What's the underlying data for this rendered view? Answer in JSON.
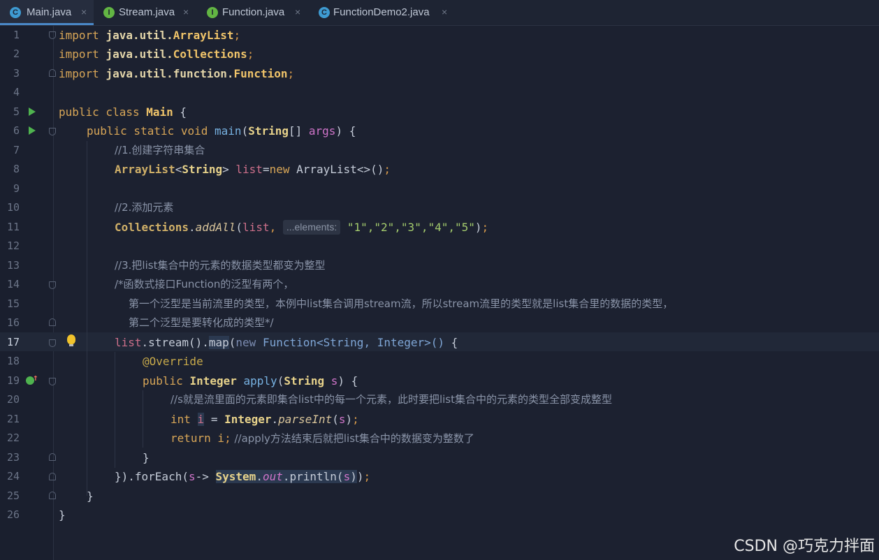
{
  "tabs": [
    {
      "label": "Main.java",
      "icon": "C",
      "kind": "class",
      "active": true
    },
    {
      "label": "Stream.java",
      "icon": "I",
      "kind": "interface",
      "active": false
    },
    {
      "label": "Function.java",
      "icon": "I",
      "kind": "interface",
      "active": false
    },
    {
      "label": "FunctionDemo2.java",
      "icon": "C",
      "kind": "class",
      "active": false
    }
  ],
  "close_glyph": "×",
  "line_numbers": [
    "1",
    "2",
    "3",
    "4",
    "5",
    "6",
    "7",
    "8",
    "9",
    "10",
    "11",
    "12",
    "13",
    "14",
    "15",
    "16",
    "17",
    "18",
    "19",
    "20",
    "21",
    "22",
    "23",
    "24",
    "25",
    "26"
  ],
  "current_line": "17",
  "code": {
    "l1": {
      "kw": "import",
      "pkg": "java.util.",
      "cls": "ArrayList",
      "semi": ";"
    },
    "l2": {
      "kw": "import",
      "pkg": "java.util.",
      "cls": "Collections",
      "semi": ";"
    },
    "l3": {
      "kw": "import",
      "pkg": "java.util.function.",
      "cls": "Function",
      "semi": ";"
    },
    "l5": {
      "kw": "public class",
      "cls": "Main",
      "rest": " {"
    },
    "l6": {
      "kw": "public static void",
      "fn": "main",
      "p1": "(",
      "ty": "String",
      "p2": "[] ",
      "arg": "args",
      "p3": ") {"
    },
    "l7": "//1.创建字符串集合",
    "l8": {
      "ty1": "ArrayList",
      "p1": "<",
      "ty2": "String",
      "p2": "> ",
      "var": "list",
      "p3": "=",
      "kw": "new",
      "p4": " ArrayList<>()",
      "semi": ";"
    },
    "l10": "//2.添加元素",
    "l11": {
      "ty": "Collections",
      "p1": ".",
      "fn": "addAll",
      "p2": "(",
      "var": "list",
      "p3": ", ",
      "hint": "...elements:",
      "strs": "\"1\",\"2\",\"3\",\"4\",\"5\"",
      "p4": ")",
      "semi": ";"
    },
    "l13": "//3.把list集合中的元素的数据类型都变为整型",
    "l14": "/*函数式接口Function的泛型有两个，",
    "l15": "第一个泛型是当前流里的类型，本例中list集合调用stream流，所以stream流里的类型就是list集合里的数据的类型，",
    "l16": "第二个泛型是要转化成的类型*/",
    "l17": {
      "var": "list",
      "p1": ".stream().",
      "map": "map",
      "p2": "(",
      "kw": "new",
      "anon": " Function<String, Integer>()",
      "p3": " {"
    },
    "l18": "@Override",
    "l19": {
      "kw": "public",
      "ty": "Integer",
      "fn": "apply",
      "p1": "(",
      "ty2": "String",
      "arg": "s",
      "p2": ") {"
    },
    "l20": "//s就是流里面的元素即集合list中的每一个元素，此时要把list集合中的元素的类型全部变成整型",
    "l21": {
      "kw": "int",
      "var": "i",
      "p1": " = ",
      "ty": "Integer",
      "p2": ".",
      "fn": "parseInt",
      "p3": "(",
      "arg": "s",
      "p4": ")",
      "semi": ";"
    },
    "l22": {
      "kw": "return",
      "v": " i",
      "semi": ";",
      "cm": " //apply方法结束后就把list集合中的数据变为整数了"
    },
    "l23": "}",
    "l24": {
      "p1": "}).forEach(",
      "arg": "s",
      "p2": "-> ",
      "cls": "System",
      "p3": ".",
      "fld": "out",
      "p4": ".println(",
      "arg2": "s",
      "p5": ")",
      "p6": ")",
      "semi": ";"
    },
    "l25": "}",
    "l26": "}"
  },
  "watermark": "CSDN @巧克力拌面",
  "colors": {
    "accent": "#4a88c7",
    "background": "#1c2130",
    "keyword": "#d8a657",
    "string": "#a4cc6d",
    "comment": "#8a94a8"
  }
}
